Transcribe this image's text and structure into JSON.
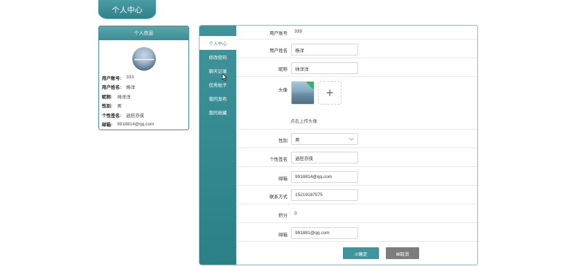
{
  "header": {
    "tab_title": "个人中心"
  },
  "info_card": {
    "title": "个人信息",
    "rows": [
      {
        "key": "用户账号:",
        "value": "333"
      },
      {
        "key": "用户姓名:",
        "value": "杨洋"
      },
      {
        "key": "昵称:",
        "value": "帅洋洋"
      },
      {
        "key": "性别:",
        "value": "男"
      },
      {
        "key": "个性签名:",
        "value": "逍狂亦侠"
      },
      {
        "key": "邮箱:",
        "value": "9918814@qq.com"
      }
    ]
  },
  "sidebar": {
    "items": [
      {
        "label": "个人中心"
      },
      {
        "label": "修改密码"
      },
      {
        "label": "聊天记录"
      },
      {
        "label": "优秀帖子"
      },
      {
        "label": "我的发布"
      },
      {
        "label": "我的收藏"
      }
    ]
  },
  "form": {
    "account_label": "用户账号",
    "account_value": "333",
    "name_label": "用户姓名",
    "name_value": "杨洋",
    "nickname_label": "昵称",
    "nickname_value": "帅洋洋",
    "avatar_label": "头像",
    "upload_hint": "点击上传头像",
    "upload_plus": "+",
    "gender_label": "性别",
    "gender_value": "男",
    "signature_label": "个性签名",
    "signature_value": "逍狂亦侠",
    "email_label": "邮箱",
    "email_value": "9918814@qq.com",
    "phone_label": "联系方式",
    "phone_value": "15219187575",
    "points_label": "积分",
    "points_value": "0",
    "email2_label": "邮箱",
    "email2_value": "991881@qq.com"
  },
  "buttons": {
    "confirm": "⊙确定",
    "cancel": "⊠取消"
  },
  "colors": {
    "accent": "#3f949a",
    "cancel": "#7d7d7d"
  }
}
